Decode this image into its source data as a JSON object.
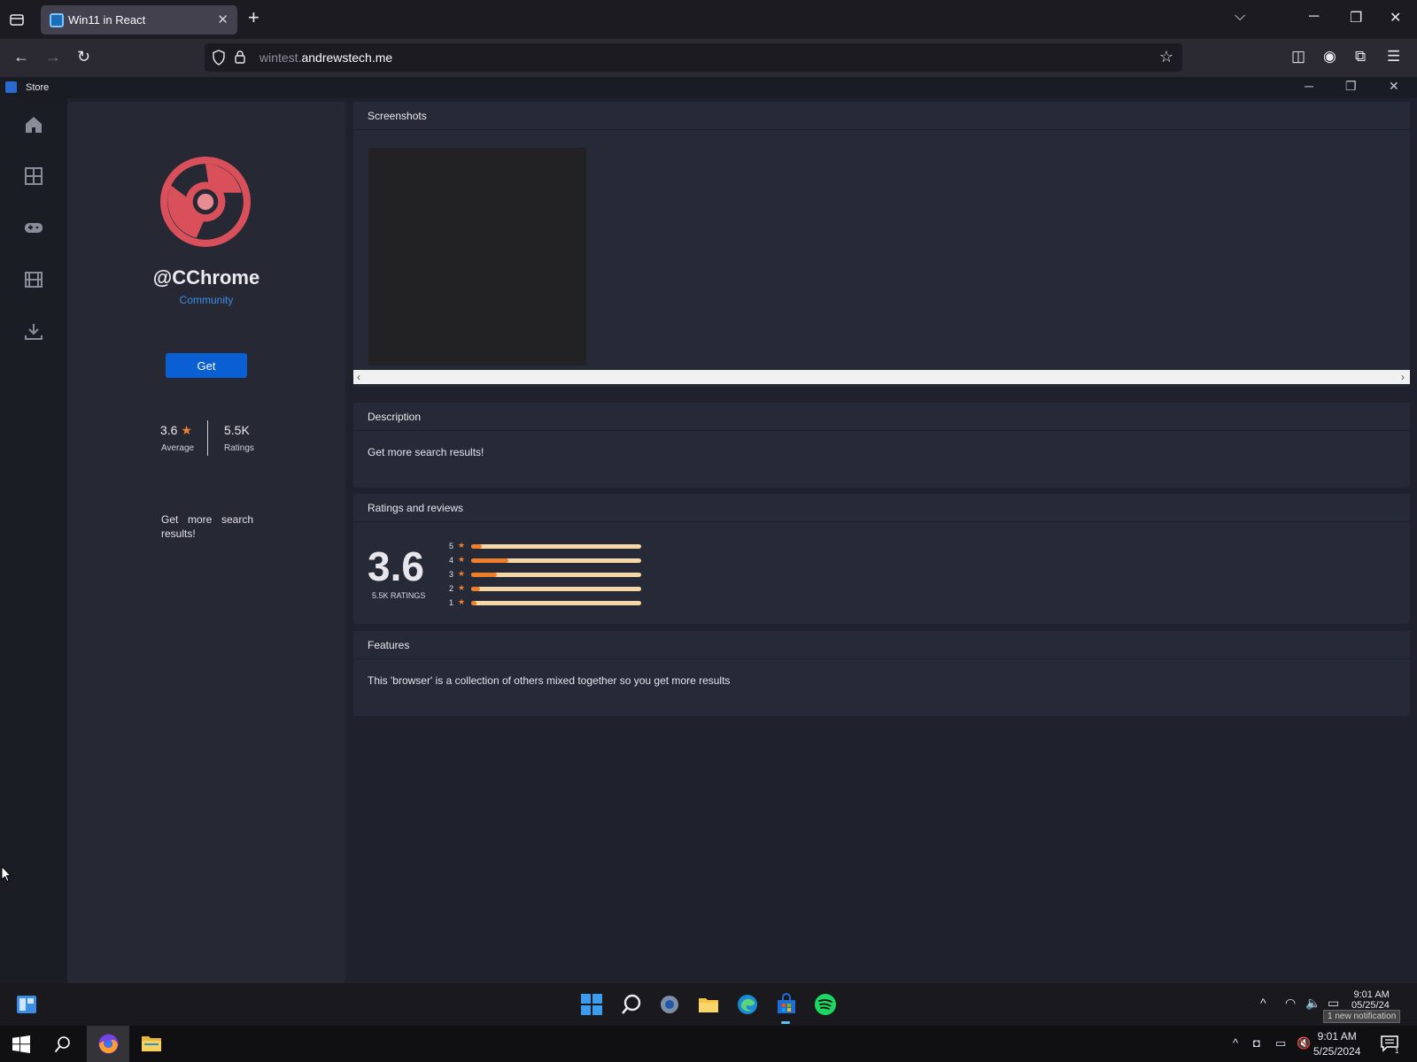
{
  "browser": {
    "tab_title": "Win11 in React",
    "url_prefix": "wintest.",
    "url_domain": "andrewstech.me"
  },
  "store": {
    "window_title": "Store",
    "app": {
      "name": "@CChrome",
      "publisher": "Community",
      "get_label": "Get",
      "rating": "3.6",
      "rating_label": "Average",
      "ratings_count": "5.5K",
      "ratings_count_label": "Ratings",
      "short_description": "Get more search results!"
    },
    "sections": {
      "screenshots": "Screenshots",
      "description": "Description",
      "description_text": "Get more search results!",
      "ratings": "Ratings and reviews",
      "big_rating": "3.6",
      "big_rating_label": "5.5K RATINGS",
      "features": "Features",
      "features_text": "This 'browser' is a collection of others mixed together so you get more results"
    },
    "rating_bars": [
      {
        "stars": "5",
        "fraction": 0.06
      },
      {
        "stars": "4",
        "fraction": 0.22
      },
      {
        "stars": "3",
        "fraction": 0.15
      },
      {
        "stars": "2",
        "fraction": 0.05
      },
      {
        "stars": "1",
        "fraction": 0.03
      }
    ]
  },
  "taskbar": {
    "inner_time": "9:01 AM",
    "inner_date": "05/25/24",
    "notification_tip": "1 new notification",
    "host_time": "9:01 AM",
    "host_date": "5/25/2024",
    "notification_count": "1"
  },
  "colors": {
    "accent": "#0a5fd3",
    "star": "#f08030",
    "logo": "#d9505a"
  }
}
